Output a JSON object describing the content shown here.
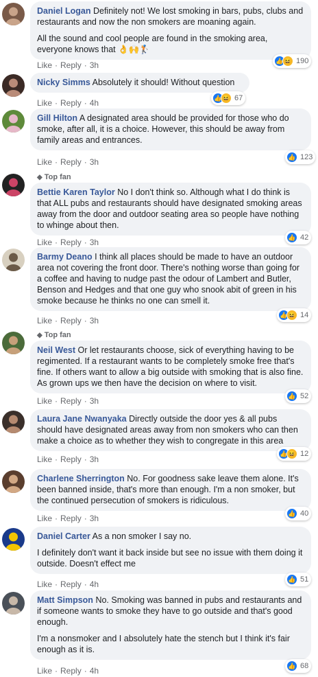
{
  "labels": {
    "like": "Like",
    "reply": "Reply",
    "dot": "·",
    "top_fan": "Top fan"
  },
  "colors": {
    "author": "#385898",
    "bubble": "#f0f2f5",
    "like_icon": "#1877f2",
    "haha_icon": "#f7b928"
  },
  "comments": [
    {
      "author": "Daniel Logan",
      "paragraphs": [
        "Definitely not! We lost smoking in bars, pubs, clubs and restaurants and now the non smokers are moaning again.",
        "All the sound and cool people are found in the smoking area, everyone knows that 👌🙌🏌"
      ],
      "time": "3h",
      "reactions": [
        "like-icon",
        "haha-icon"
      ],
      "count": "190",
      "top_fan": false
    },
    {
      "author": "Nicky Simms",
      "paragraphs": [
        "Absolutely it should! Without question"
      ],
      "time": "4h",
      "reactions": [
        "like-icon",
        "haha-icon"
      ],
      "count": "67",
      "top_fan": false
    },
    {
      "author": "Gill Hilton",
      "paragraphs": [
        "A designated area should be provided for those who do smoke, after all, it is a choice. However, this should be away from family areas and entrances."
      ],
      "time": "3h",
      "reactions": [
        "like-icon"
      ],
      "count": "123",
      "top_fan": false
    },
    {
      "author": "Bettie Karen Taylor",
      "paragraphs": [
        "No I don't think so. Although what I do think is that ALL pubs and restaurants should have designated smoking areas away from the door and outdoor seating area so people have nothing to whinge about then."
      ],
      "time": "3h",
      "reactions": [
        "like-icon"
      ],
      "count": "42",
      "top_fan": true
    },
    {
      "author": "Barmy Deano",
      "paragraphs": [
        "I think all places should be made to have an outdoor area not covering the front door. There's nothing worse than going for a coffee and having to nudge past the odour of Lambert and Butler, Benson and Hedges and that one guy who snook abit of green in his smoke because he thinks no one can smell it."
      ],
      "time": "3h",
      "reactions": [
        "like-icon",
        "haha-icon"
      ],
      "count": "14",
      "top_fan": false
    },
    {
      "author": "Neil West",
      "paragraphs": [
        "Or let restaurants choose, sick of everything having to be regimented. If a restaurant wants to be completely smoke free that's fine. If others want to allow a big outside with smoking that is also fine. As grown ups we then have the decision on where to visit."
      ],
      "time": "3h",
      "reactions": [
        "like-icon"
      ],
      "count": "52",
      "top_fan": true
    },
    {
      "author": "Laura Jane Nwanyaka",
      "paragraphs": [
        "Directly outside the door yes & all pubs should have designated areas away from non smokers who can then make a choice as to whether they wish to congregate in this area"
      ],
      "time": "3h",
      "reactions": [
        "like-icon",
        "haha-icon"
      ],
      "count": "12",
      "top_fan": false
    },
    {
      "author": "Charlene Sherrington",
      "paragraphs": [
        "No. For goodness sake leave them alone. It's been banned inside, that's more than enough. I'm a non smoker, but the continued persecution of smokers is ridiculous."
      ],
      "time": "3h",
      "reactions": [
        "like-icon"
      ],
      "count": "40",
      "top_fan": false
    },
    {
      "author": "Daniel Carter",
      "paragraphs": [
        "As a non smoker I say no.",
        "I definitely don't want it back inside but see no issue with them doing it outside. Doesn't effect me"
      ],
      "time": "4h",
      "reactions": [
        "like-icon"
      ],
      "count": "51",
      "top_fan": false
    },
    {
      "author": "Matt Simpson",
      "paragraphs": [
        "No. Smoking was banned in pubs and restaurants and if someone wants to smoke they have to go outside and that's good enough.",
        "I'm a nonsmoker and I absolutely hate the stench but I think it's fair enough as it is."
      ],
      "time": "4h",
      "reactions": [
        "like-icon"
      ],
      "count": "68",
      "top_fan": false
    }
  ]
}
